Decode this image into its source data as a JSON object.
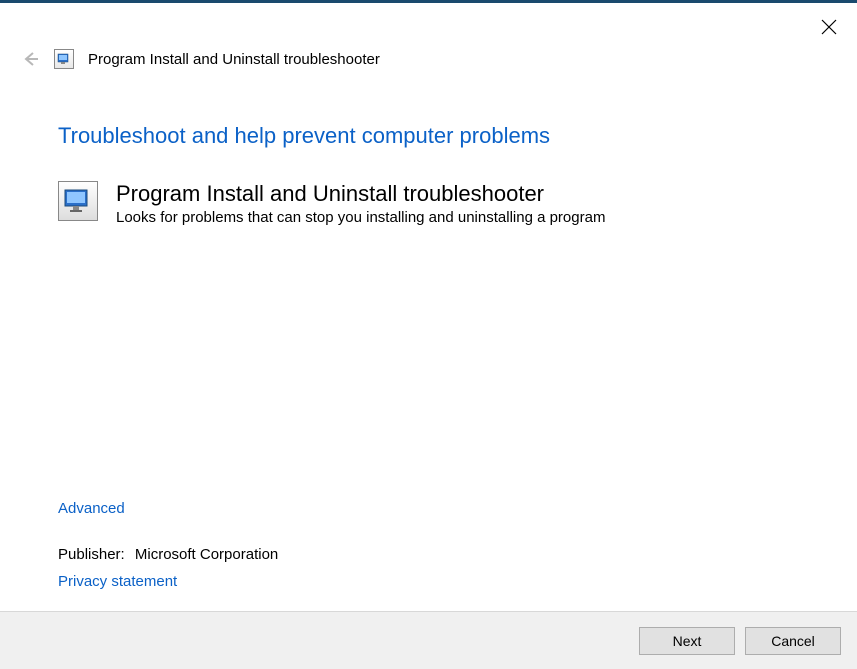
{
  "header": {
    "title": "Program Install and Uninstall troubleshooter"
  },
  "main": {
    "heading": "Troubleshoot and help prevent computer problems",
    "program_title": "Program Install and Uninstall troubleshooter",
    "program_desc": "Looks for problems that can stop you installing and uninstalling a program"
  },
  "links": {
    "advanced": "Advanced",
    "publisher_label": "Publisher:",
    "publisher_value": "Microsoft Corporation",
    "privacy": "Privacy statement"
  },
  "footer": {
    "next": "Next",
    "cancel": "Cancel"
  }
}
